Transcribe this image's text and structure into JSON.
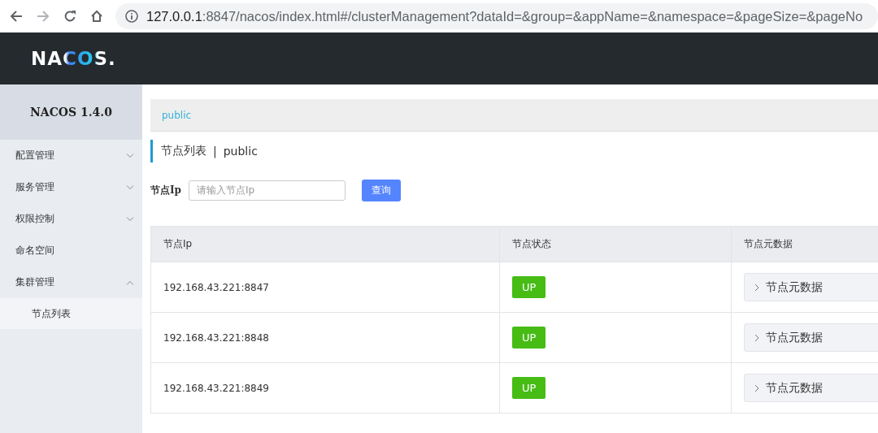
{
  "browser": {
    "url_host": "127.0.0.1",
    "url_path": ":8847/nacos/index.html#/clusterManagement?dataId=&group=&appName=&namespace=&pageSize=&pageNo"
  },
  "header": {
    "logo": "NACOS."
  },
  "sidebar": {
    "title": "NACOS 1.4.0",
    "items": [
      {
        "label": "配置管理",
        "expanded": false
      },
      {
        "label": "服务管理",
        "expanded": false
      },
      {
        "label": "权限控制",
        "expanded": false
      },
      {
        "label": "命名空间"
      },
      {
        "label": "集群管理",
        "expanded": true,
        "children": [
          {
            "label": "节点列表",
            "selected": true
          }
        ]
      }
    ]
  },
  "breadcrumb": "public",
  "page_title": {
    "title": "节点列表",
    "separator": "|",
    "namespace": "public"
  },
  "search": {
    "label": "节点Ip",
    "placeholder": "请输入节点Ip",
    "button": "查询"
  },
  "table": {
    "columns": [
      "节点Ip",
      "节点状态",
      "节点元数据"
    ],
    "rows": [
      {
        "ip": "192.168.43.221:8847",
        "status": "UP",
        "metadata": "节点元数据",
        "expanded": false
      },
      {
        "ip": "192.168.43.221:8848",
        "status": "UP",
        "metadata": "节点元数据",
        "expanded": false
      },
      {
        "ip": "192.168.43.221:8849",
        "status": "UP",
        "metadata": "节点元数据",
        "expanded": false
      }
    ]
  }
}
